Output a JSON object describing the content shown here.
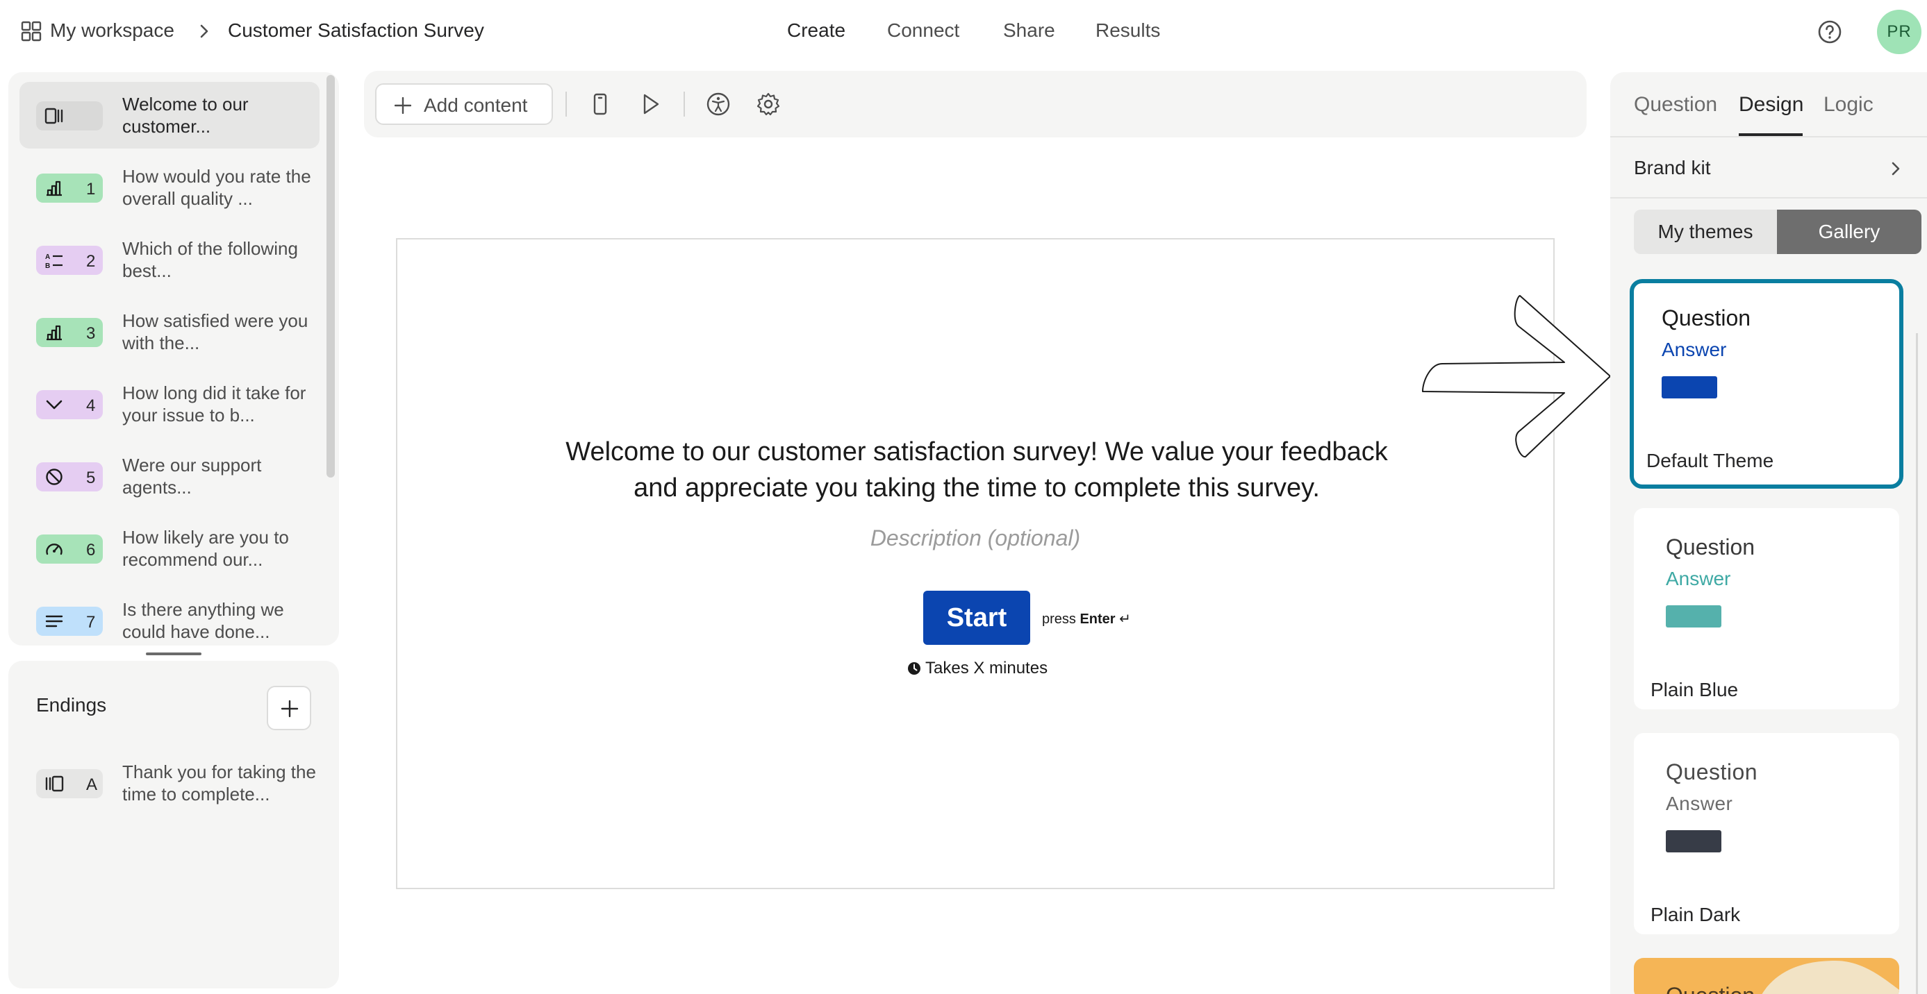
{
  "header": {
    "workspace_label": "My workspace",
    "survey_title": "Customer Satisfaction Survey",
    "nav": [
      "Create",
      "Connect",
      "Share",
      "Results"
    ],
    "active_nav": "Create",
    "avatar_initials": "PR"
  },
  "questions": [
    {
      "num": "",
      "text": "Welcome to our customer...",
      "type": "welcome",
      "color": "#e6e6e5",
      "selected": true
    },
    {
      "num": "1",
      "text": "How would you rate the overall quality ...",
      "type": "rating",
      "color": "#a7e3b8"
    },
    {
      "num": "2",
      "text": "Which of the following best...",
      "type": "multiple-choice",
      "color": "#e5cdf2"
    },
    {
      "num": "3",
      "text": "How satisfied were you with the...",
      "type": "rating",
      "color": "#a7e3b8"
    },
    {
      "num": "4",
      "text": "How long did it take for your issue to b...",
      "type": "dropdown",
      "color": "#e5cdf2"
    },
    {
      "num": "5",
      "text": "Were our support agents...",
      "type": "yes-no",
      "color": "#e5cdf2"
    },
    {
      "num": "6",
      "text": "How likely are you to recommend our...",
      "type": "nps",
      "color": "#a7e3b8"
    },
    {
      "num": "7",
      "text": "Is there anything we could have done...",
      "type": "long-text",
      "color": "#bfe0fb"
    }
  ],
  "endings": {
    "title": "Endings",
    "items": [
      {
        "num": "A",
        "text": "Thank you for taking the time to complete...",
        "color": "#e6e6e5"
      }
    ]
  },
  "toolbar": {
    "add_content_label": "Add content"
  },
  "canvas": {
    "welcome_text": "Welcome to our customer satisfaction survey! We value your feedback and appreciate you taking the time to complete this survey.",
    "description_placeholder": "Description (optional)",
    "start_label": "Start",
    "press_prefix": "press",
    "press_key": "Enter",
    "press_symbol": "↵",
    "takes_text": "Takes X minutes"
  },
  "right_panel": {
    "tabs": [
      "Question",
      "Design",
      "Logic"
    ],
    "active_tab": "Design",
    "brand_kit_label": "Brand kit",
    "theme_toggle": [
      "My themes",
      "Gallery"
    ],
    "active_toggle": "Gallery",
    "themes": [
      {
        "question": "Question",
        "answer": "Answer",
        "name": "Default Theme",
        "answer_color": "#0b45b0",
        "swatch_color": "#0b45b0",
        "selected": true
      },
      {
        "question": "Question",
        "answer": "Answer",
        "name": "Plain Blue",
        "answer_color": "#3ea9a4",
        "swatch_color": "#55b1ac"
      },
      {
        "question": "Question",
        "answer": "Answer",
        "name": "Plain Dark",
        "answer_color": "#6b6b6b",
        "swatch_color": "#373c47"
      }
    ],
    "partial_theme_question": "Question"
  },
  "colors": {
    "accent_blue": "#0b45b0",
    "selected_border": "#0a7ea0",
    "panel_bg": "#f5f5f4"
  }
}
